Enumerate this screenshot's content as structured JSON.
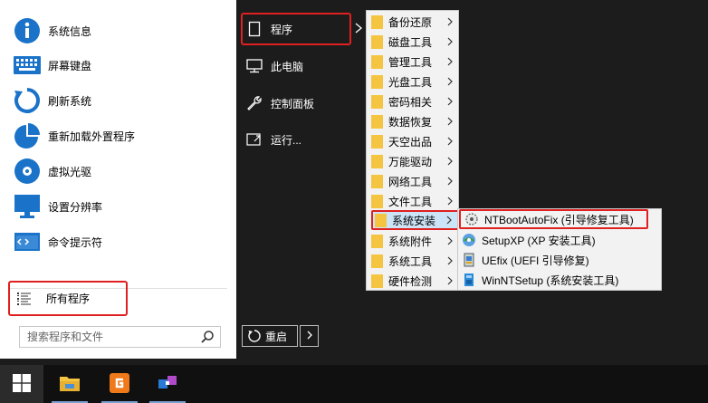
{
  "left_panel": {
    "items": [
      {
        "label": "系统信息",
        "icon": "info-icon"
      },
      {
        "label": "屏幕键盘",
        "icon": "keyboard-icon"
      },
      {
        "label": "刷新系统",
        "icon": "refresh-icon"
      },
      {
        "label": "重新加载外置程序",
        "icon": "pie-chart-icon"
      },
      {
        "label": "虚拟光驱",
        "icon": "disc-icon"
      },
      {
        "label": "设置分辨率",
        "icon": "monitor-icon"
      },
      {
        "label": "命令提示符",
        "icon": "command-prompt-icon"
      }
    ],
    "all_programs": "所有程序",
    "search_placeholder": "搜索程序和文件"
  },
  "middle_column": {
    "programs": "程序",
    "this_pc": "此电脑",
    "control_panel": "控制面板",
    "run": "运行...",
    "restart": "重启"
  },
  "submenu": {
    "items": [
      "备份还原",
      "磁盘工具",
      "管理工具",
      "光盘工具",
      "密码相关",
      "数据恢复",
      "天空出品",
      "万能驱动",
      "网络工具",
      "文件工具",
      "系统安装",
      "系统附件",
      "系统工具",
      "硬件检测"
    ],
    "active": "系统安装"
  },
  "submenu2": {
    "items": [
      "NTBootAutoFix (引导修复工具)",
      "SetupXP (XP 安装工具)",
      "UEfix (UEFI 引导修复)",
      "WinNTSetup (系统安装工具)"
    ]
  },
  "colors": {
    "highlight_red": "#e02020",
    "accent_blue": "#1a73c9",
    "folder_yellow": "#f5c542"
  }
}
